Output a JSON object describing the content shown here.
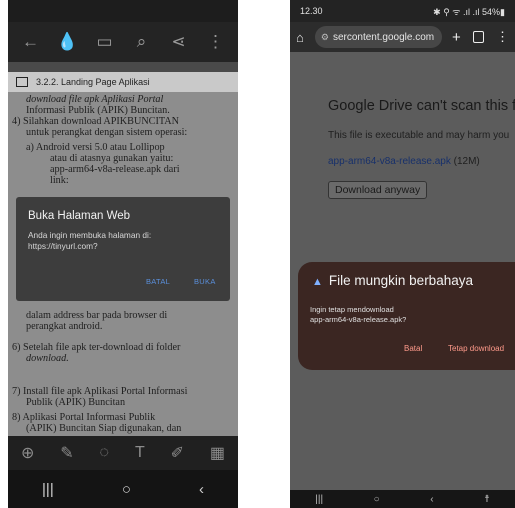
{
  "left": {
    "toolbar": {
      "back": "←",
      "ink": "💧",
      "comment": "▭",
      "search": "⌕",
      "share": "⋖",
      "more": "⋮"
    },
    "section_title": "3.2.2. Landing Page Aplikasi",
    "doc_lines": [
      "download file apk Aplikasi Portal",
      "Informasi Publik (APIK) Buncitan.",
      "4)   Silahkan download APIKBUNCITAN",
      "untuk perangkat dengan sistem operasi:",
      "a)   Android versi 5.0 atau Lollipop",
      "atau di atasnya gunakan yaitu:",
      "app-arm64-v8a-release.apk dari",
      "link:",
      "dalam address bar pada browser di",
      "perangkat android.",
      "6)   Setelah file apk ter-download di folder",
      "download.",
      "7)   Install file apk Aplikasi Portal Informasi",
      "Publik (APIK) Buncitan",
      "8)   Aplikasi Portal Informasi Publik",
      "(APIK) Buncitan Siap digunakan, dan"
    ],
    "dialog": {
      "title": "Buka Halaman Web",
      "message": "Anda ingin membuka halaman di: https://tinyurl.com?",
      "cancel": "BATAL",
      "open": "BUKA"
    },
    "bottom_tools": [
      "⊕",
      "✎",
      "◌",
      "T",
      "✐",
      "▦"
    ],
    "nav": {
      "recent": "|||",
      "home": "○",
      "back": "‹"
    }
  },
  "right": {
    "status": {
      "time": "12.30",
      "indicators": "✱ ⚲ ᯤ .ıl .ıl 54%▮"
    },
    "url": "sercontent.google.com",
    "page": {
      "heading": "Google Drive can't scan this file f",
      "subtext": "This file is executable and may harm you",
      "file_name": "app-arm64-v8a-release.apk",
      "file_size": "(12M)",
      "download_button": "Download anyway"
    },
    "dialog": {
      "title": "File mungkin berbahaya",
      "message_line1": "Ingin tetap mendownload",
      "message_line2": "app-arm64-v8a-release.apk?",
      "cancel": "Batal",
      "confirm": "Tetap download"
    },
    "nav": {
      "recent": "|||",
      "home": "○",
      "back": "‹",
      "accessibility": "☨"
    }
  }
}
